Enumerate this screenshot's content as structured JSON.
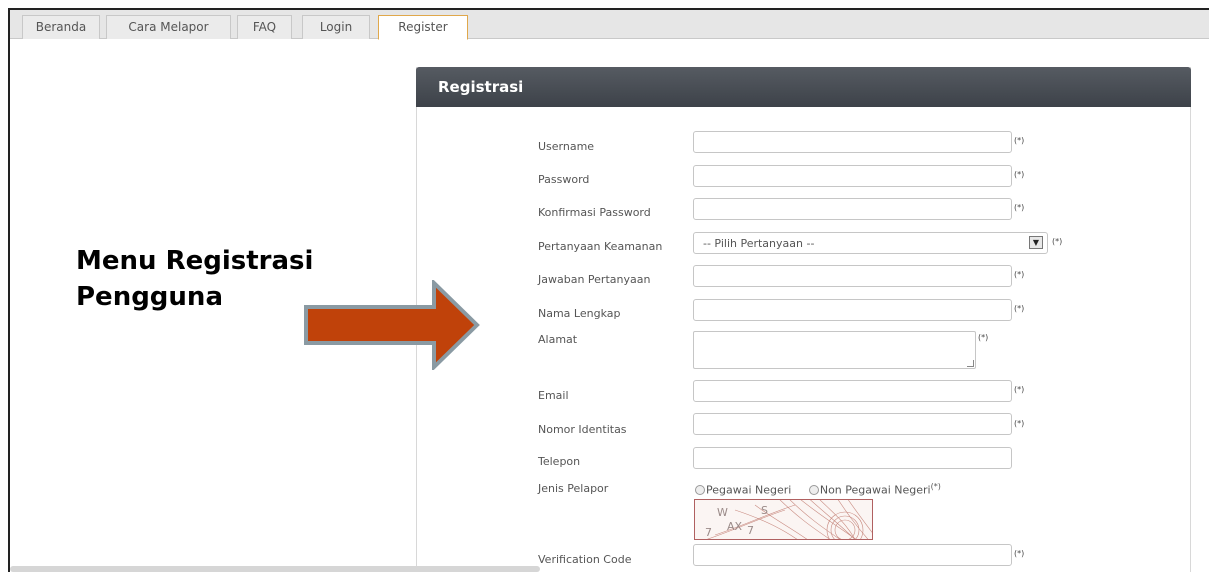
{
  "tabs": [
    {
      "label": "Beranda"
    },
    {
      "label": "Cara Melapor"
    },
    {
      "label": "FAQ"
    },
    {
      "label": "Login"
    },
    {
      "label": "Register",
      "active": true
    }
  ],
  "panel": {
    "title": "Registrasi"
  },
  "form": {
    "username_label": "Username",
    "password_label": "Password",
    "confirm_password_label": "Konfirmasi Password",
    "security_question_label": "Pertanyaan Keamanan",
    "security_question_selected": "-- Pilih Pertanyaan --",
    "answer_label": "Jawaban Pertanyaan",
    "full_name_label": "Nama Lengkap",
    "address_label": "Alamat",
    "email_label": "Email",
    "id_number_label": "Nomor Identitas",
    "phone_label": "Telepon",
    "reporter_type_label": "Jenis Pelapor",
    "reporter_options": [
      "Pegawai Negeri",
      "Non Pegawai Negeri"
    ],
    "captcha_text": "7 WAX7 S",
    "verification_label": "Verification Code",
    "required_marker": "(*)"
  },
  "callout": {
    "line1": "Menu Registrasi",
    "line2": "Pengguna"
  },
  "colors": {
    "header": "#474c53",
    "arrow_fill": "#c0420a",
    "arrow_border": "#8a9aa3",
    "active_tab_border": "#e0a84b"
  }
}
